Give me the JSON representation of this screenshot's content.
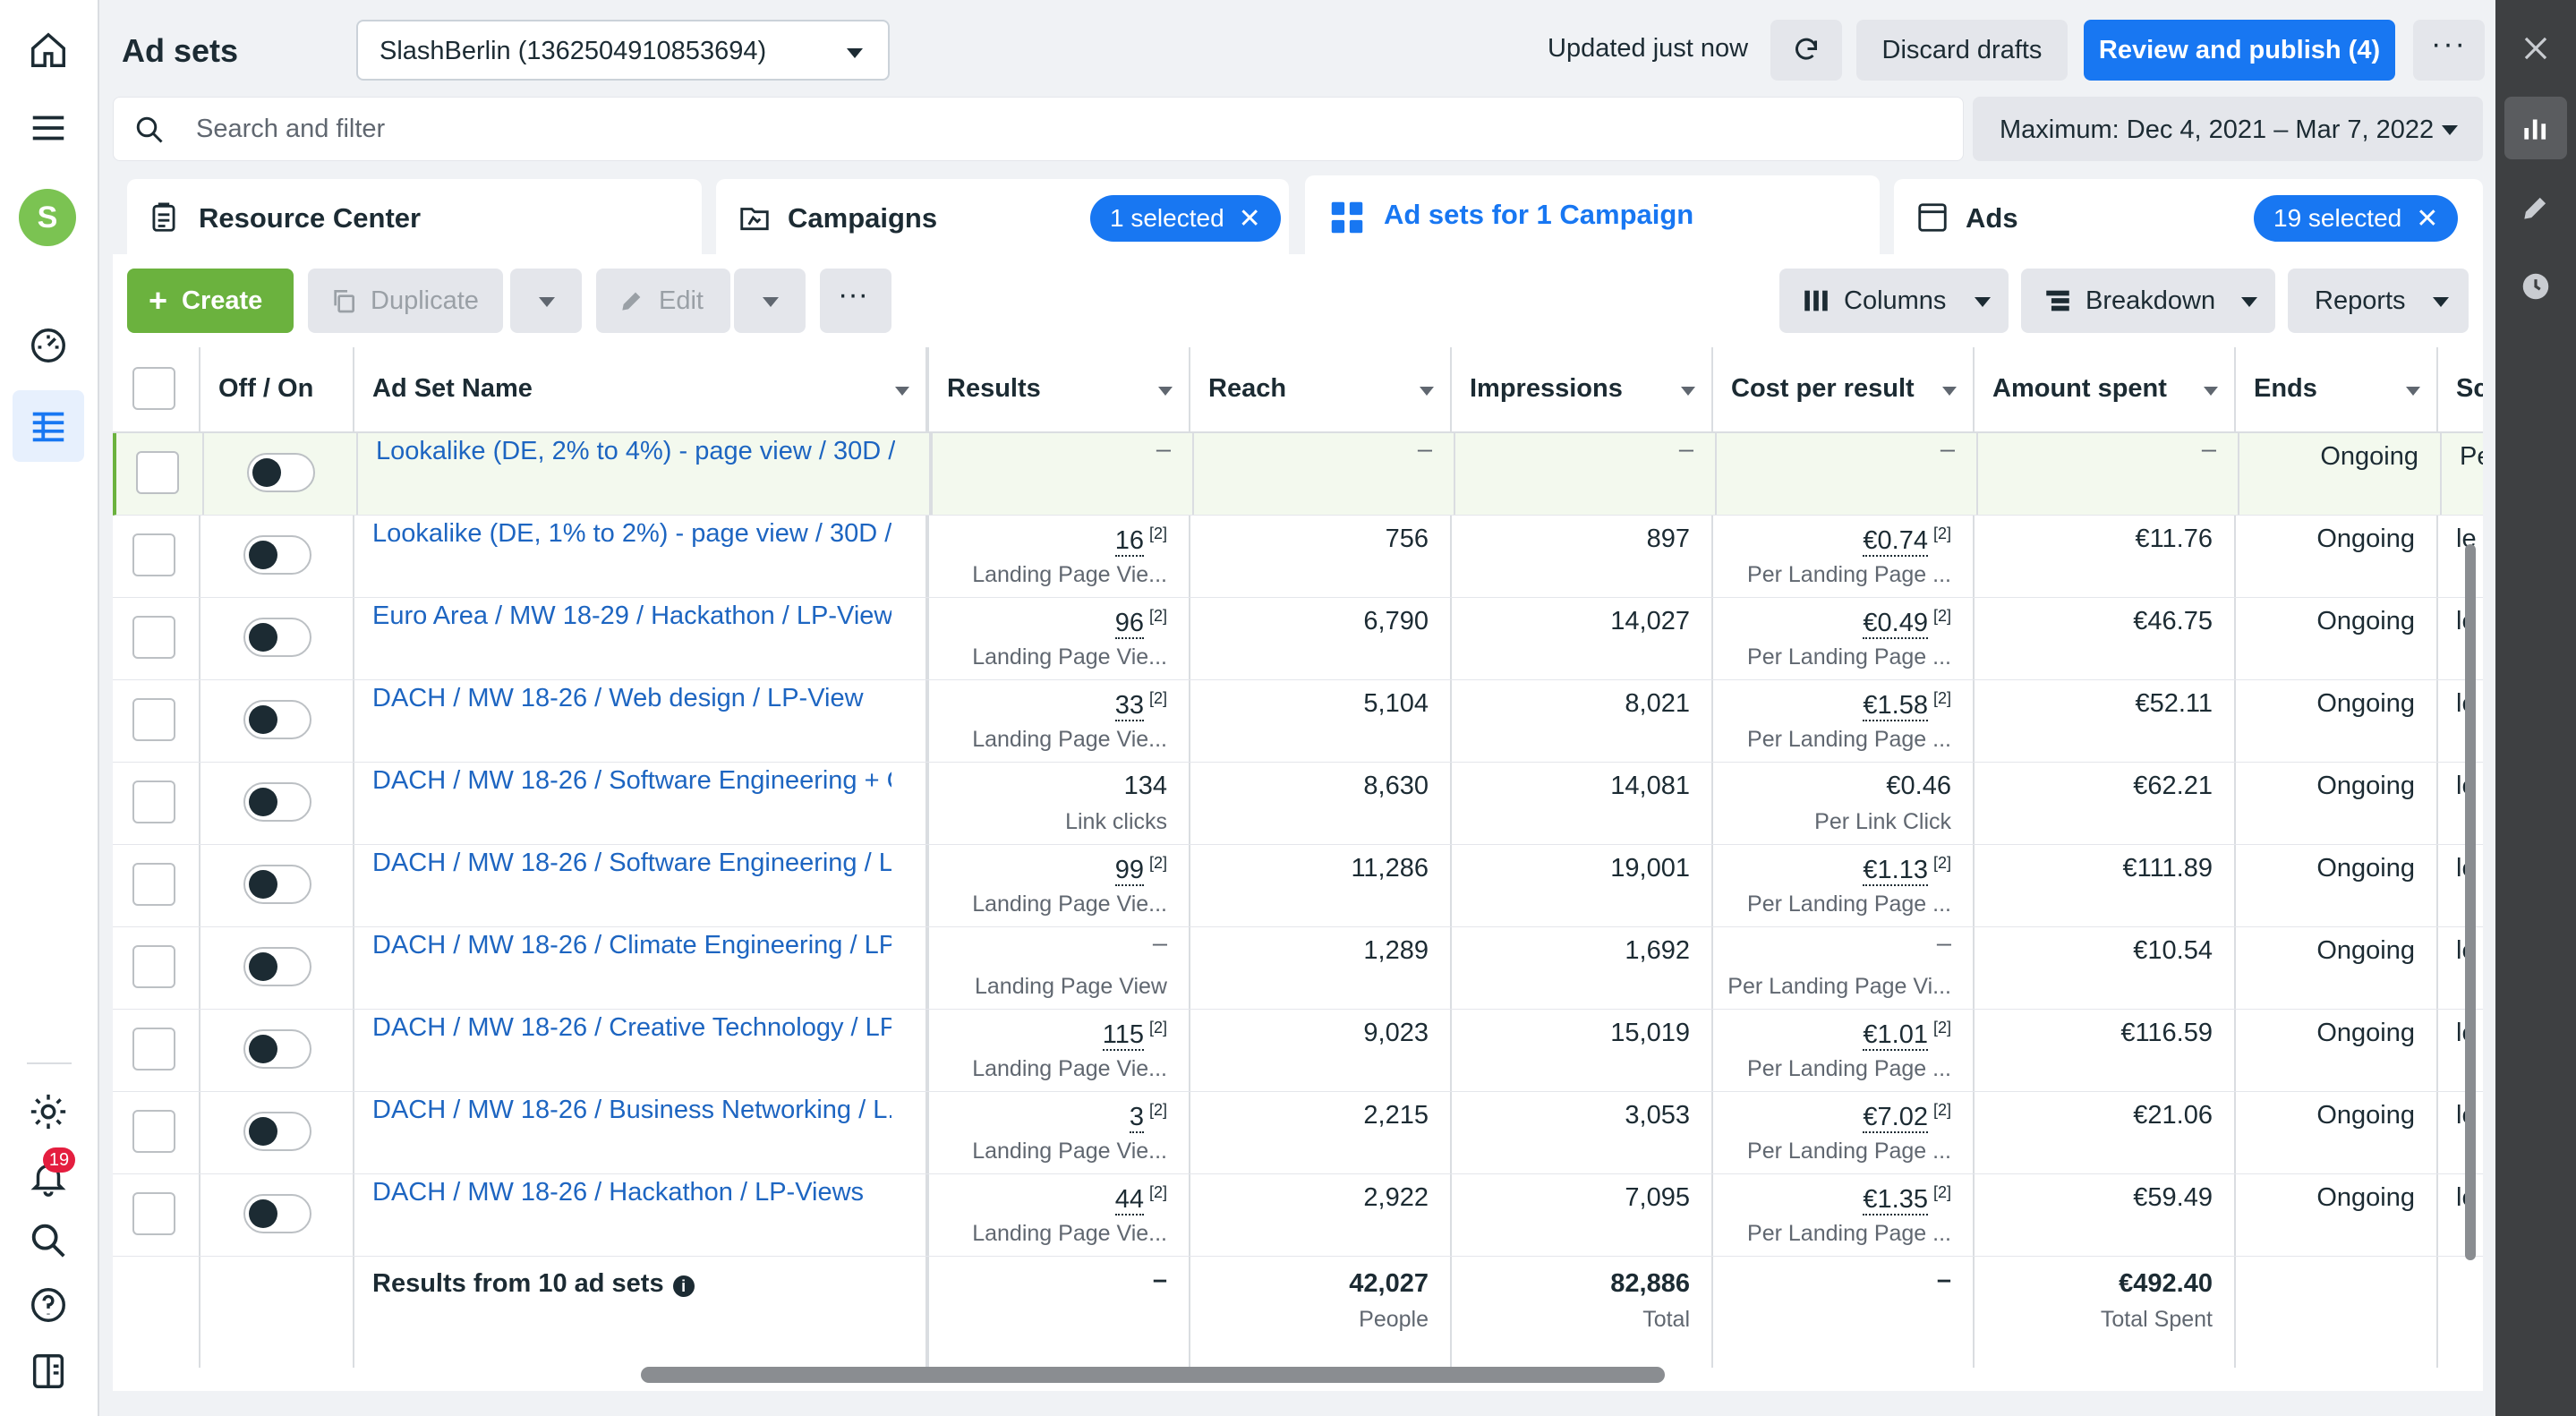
{
  "header": {
    "title": "Ad sets",
    "account": "SlashBerlin (1362504910853694)",
    "updated": "Updated just now",
    "discard": "Discard drafts",
    "publish": "Review and publish (4)"
  },
  "search": {
    "placeholder": "Search and filter"
  },
  "date_range": "Maximum: Dec 4, 2021 – Mar 7, 2022",
  "tabs": [
    {
      "label": "Resource Center"
    },
    {
      "label": "Campaigns",
      "pill": "1 selected"
    },
    {
      "label": "Ad sets for 1 Campaign"
    },
    {
      "label": "Ads",
      "pill": "19 selected"
    }
  ],
  "toolbar": {
    "create": "Create",
    "duplicate": "Duplicate",
    "edit": "Edit",
    "columns": "Columns",
    "breakdown": "Breakdown",
    "reports": "Reports"
  },
  "notifications_count": "19",
  "avatar_letter": "S",
  "table": {
    "headers": [
      "Off / On",
      "Ad Set Name",
      "Results",
      "Reach",
      "Impressions",
      "Cost per result",
      "Amount spent",
      "Ends",
      "Sc"
    ],
    "rows": [
      {
        "name": "Lookalike (DE, 2% to 4%) - page view / 30D / ...",
        "results": "–",
        "results_sub": "",
        "reach": "–",
        "impressions": "–",
        "cpr": "–",
        "cpr_sub": "",
        "spent": "–",
        "ends": "Ongoing",
        "sched": "Pe"
      },
      {
        "name": "Lookalike (DE, 1% to 2%) - page view / 30D / ...",
        "results": "16",
        "results_sub": "Landing Page Vie...",
        "reach": "756",
        "impressions": "897",
        "cpr": "€0.74",
        "cpr_sub": "Per Landing Page ...",
        "spent": "€11.76",
        "ends": "Ongoing",
        "sched": "le"
      },
      {
        "name": "Euro Area / MW 18-29 / Hackathon / LP-View...",
        "results": "96",
        "results_sub": "Landing Page Vie...",
        "reach": "6,790",
        "impressions": "14,027",
        "cpr": "€0.49",
        "cpr_sub": "Per Landing Page ...",
        "spent": "€46.75",
        "ends": "Ongoing",
        "sched": "le"
      },
      {
        "name": "DACH / MW 18-26 / Web design / LP-View",
        "results": "33",
        "results_sub": "Landing Page Vie...",
        "reach": "5,104",
        "impressions": "8,021",
        "cpr": "€1.58",
        "cpr_sub": "Per Landing Page ...",
        "spent": "€52.11",
        "ends": "Ongoing",
        "sched": "le"
      },
      {
        "name": "DACH / MW 18-26 / Software Engineering + C...",
        "results": "134",
        "results_sub": "Link clicks",
        "reach": "8,630",
        "impressions": "14,081",
        "cpr": "€0.46",
        "cpr_sub": "Per Link Click",
        "spent": "€62.21",
        "ends": "Ongoing",
        "sched": "le"
      },
      {
        "name": "DACH / MW 18-26 / Software Engineering / L...",
        "results": "99",
        "results_sub": "Landing Page Vie...",
        "reach": "11,286",
        "impressions": "19,001",
        "cpr": "€1.13",
        "cpr_sub": "Per Landing Page ...",
        "spent": "€111.89",
        "ends": "Ongoing",
        "sched": "le"
      },
      {
        "name": "DACH / MW 18-26 / Climate Engineering / LP...",
        "results": "–",
        "results_sub": "Landing Page View",
        "reach": "1,289",
        "impressions": "1,692",
        "cpr": "–",
        "cpr_sub": "Per Landing Page Vi...",
        "spent": "€10.54",
        "ends": "Ongoing",
        "sched": "le"
      },
      {
        "name": "DACH / MW 18-26 / Creative Technology / LP...",
        "results": "115",
        "results_sub": "Landing Page Vie...",
        "reach": "9,023",
        "impressions": "15,019",
        "cpr": "€1.01",
        "cpr_sub": "Per Landing Page ...",
        "spent": "€116.59",
        "ends": "Ongoing",
        "sched": "le"
      },
      {
        "name": "DACH / MW 18-26 / Business Networking / L...",
        "results": "3",
        "results_sub": "Landing Page Vie...",
        "reach": "2,215",
        "impressions": "3,053",
        "cpr": "€7.02",
        "cpr_sub": "Per Landing Page ...",
        "spent": "€21.06",
        "ends": "Ongoing",
        "sched": "le"
      },
      {
        "name": "DACH / MW 18-26 / Hackathon / LP-Views",
        "results": "44",
        "results_sub": "Landing Page Vie...",
        "reach": "2,922",
        "impressions": "7,095",
        "cpr": "€1.35",
        "cpr_sub": "Per Landing Page ...",
        "spent": "€59.49",
        "ends": "Ongoing",
        "sched": "le"
      }
    ],
    "footnote_marker": "[2]",
    "summary": {
      "label": "Results from 10 ad sets",
      "results": "–",
      "reach": "42,027",
      "reach_sub": "People",
      "impressions": "82,886",
      "impressions_sub": "Total",
      "cpr": "–",
      "spent": "€492.40",
      "spent_sub": "Total Spent"
    }
  },
  "colors": {
    "accent": "#1877f2",
    "create": "#6bb23e",
    "link": "#1d65c1",
    "draft_row": "#f3f9ee"
  }
}
